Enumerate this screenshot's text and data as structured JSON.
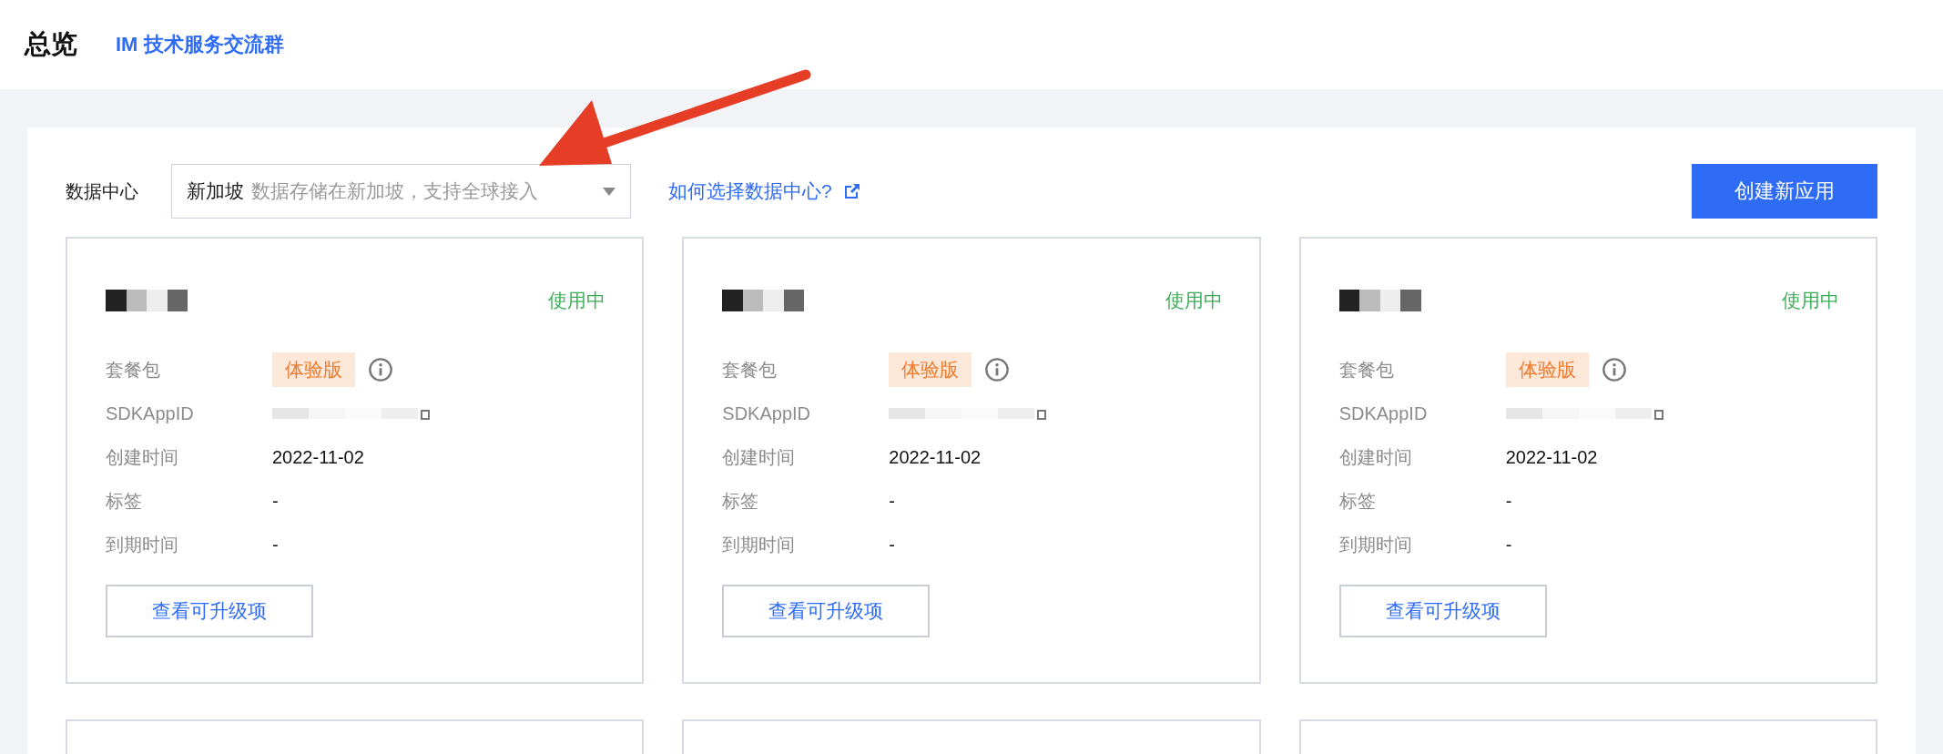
{
  "header": {
    "title": "总览",
    "link": "IM 技术服务交流群"
  },
  "toolbar": {
    "label": "数据中心",
    "select": {
      "value": "新加坡",
      "description": "数据存储在新加坡，支持全球接入"
    },
    "help_link": "如何选择数据中心?",
    "create_button": "创建新应用"
  },
  "cards": [
    {
      "name_redacted": true,
      "status": "使用中",
      "fields": [
        {
          "label": "套餐包",
          "kind": "badge",
          "value": "体验版"
        },
        {
          "label": "SDKAppID",
          "kind": "redacted",
          "redacted": true
        },
        {
          "label": "创建时间",
          "kind": "text",
          "value": "2022-11-02"
        },
        {
          "label": "标签",
          "kind": "text",
          "value": "-"
        },
        {
          "label": "到期时间",
          "kind": "text",
          "value": "-"
        }
      ],
      "button": "查看可升级项"
    },
    {
      "name_redacted": true,
      "status": "使用中",
      "fields": [
        {
          "label": "套餐包",
          "kind": "badge",
          "value": "体验版"
        },
        {
          "label": "SDKAppID",
          "kind": "redacted",
          "redacted": true
        },
        {
          "label": "创建时间",
          "kind": "text",
          "value": "2022-11-02"
        },
        {
          "label": "标签",
          "kind": "text",
          "value": "-"
        },
        {
          "label": "到期时间",
          "kind": "text",
          "value": "-"
        }
      ],
      "button": "查看可升级项"
    },
    {
      "name_redacted": true,
      "status": "使用中",
      "fields": [
        {
          "label": "套餐包",
          "kind": "badge",
          "value": "体验版"
        },
        {
          "label": "SDKAppID",
          "kind": "redacted",
          "redacted": true
        },
        {
          "label": "创建时间",
          "kind": "text",
          "value": "2022-11-02"
        },
        {
          "label": "标签",
          "kind": "text",
          "value": "-"
        },
        {
          "label": "到期时间",
          "kind": "text",
          "value": "-"
        }
      ],
      "button": "查看可升级项"
    }
  ],
  "more_cards": [
    {
      "kind": "cut-off"
    },
    {
      "kind": "cut-off"
    },
    {
      "kind": "cut-off"
    }
  ]
}
